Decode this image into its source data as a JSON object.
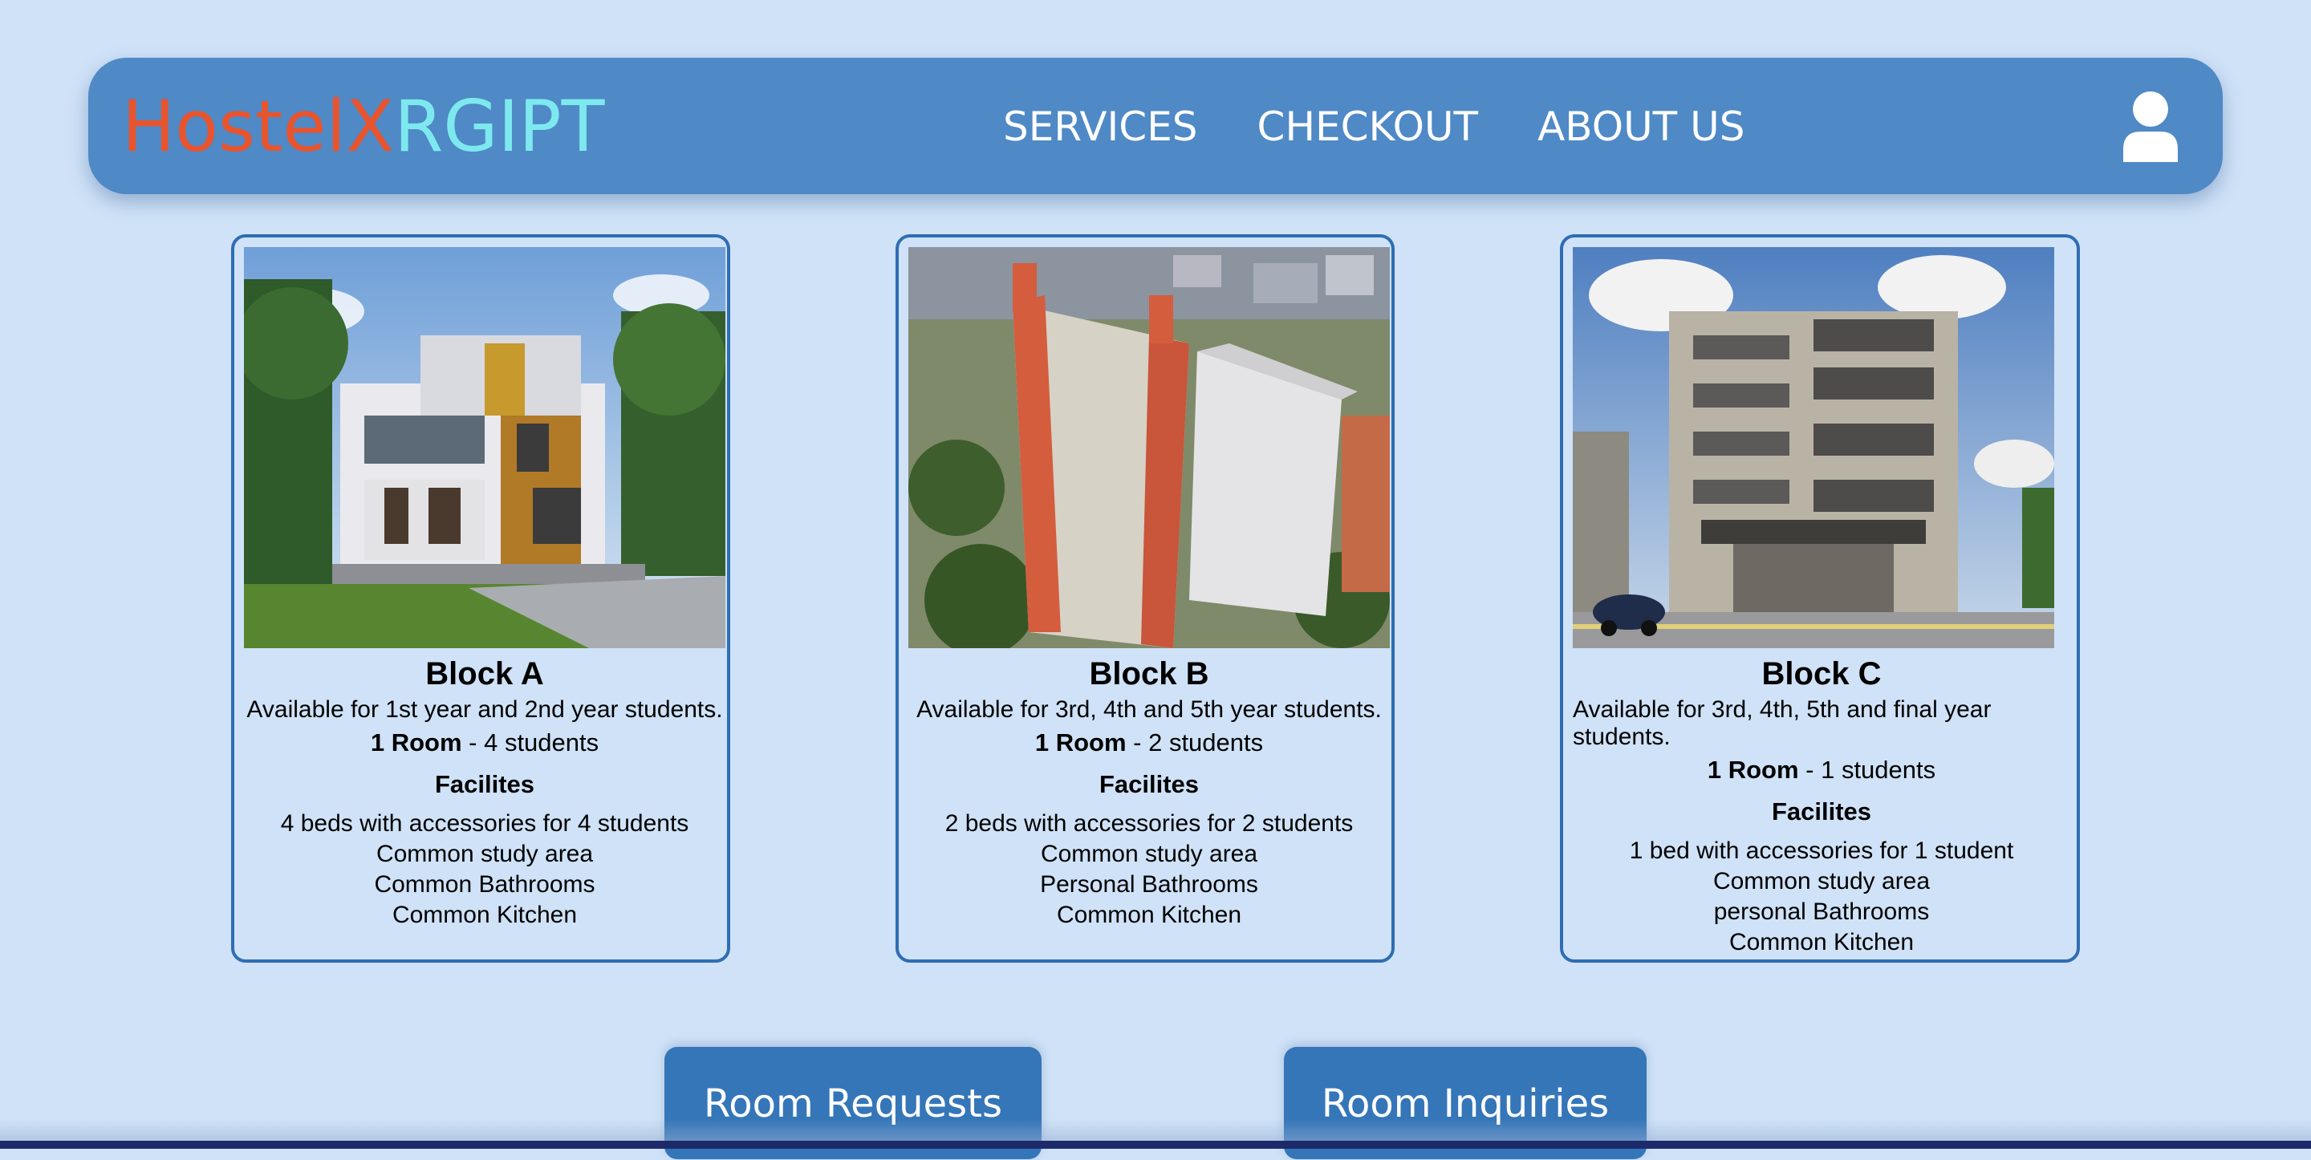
{
  "navbar": {
    "logo_part1": "HostelX",
    "logo_part2": "RGIPT",
    "links": [
      "SERVICES",
      "CHECKOUT",
      "ABOUT US"
    ],
    "user_icon": "user-icon"
  },
  "cards": [
    {
      "title": "Block A",
      "availability": "Available for 1st year and 2nd year students.",
      "room_label": "1 Room",
      "room_capacity": "- 4 students",
      "facilities_title": "Facilites",
      "facilities": [
        "4 beds with accessories for 4 students",
        "Common study area",
        "Common Bathrooms",
        "Common Kitchen"
      ]
    },
    {
      "title": "Block B",
      "availability": "Available for 3rd, 4th and 5th year students.",
      "room_label": "1 Room",
      "room_capacity": "- 2 students",
      "facilities_title": "Facilites",
      "facilities": [
        "2 beds with accessories for 2 students",
        "Common study area",
        "Personal Bathrooms",
        "Common Kitchen"
      ]
    },
    {
      "title": "Block C",
      "availability": "Available for 3rd, 4th, 5th and final year students.",
      "room_label": "1 Room",
      "room_capacity": "- 1 students",
      "facilities_title": "Facilites",
      "facilities": [
        "1 bed with accessories for 1 student",
        "Common study area",
        "personal Bathrooms",
        "Common Kitchen"
      ]
    }
  ],
  "actions": {
    "room_requests": "Room Requests",
    "room_inquiries": "Room Inquiries"
  },
  "colors": {
    "background": "#cfe2f7",
    "navbar": "#4f89c6",
    "logo_orange": "#e8542e",
    "logo_cyan": "#7de9ef",
    "card_border": "#2f6db3",
    "button": "#3576b8"
  }
}
